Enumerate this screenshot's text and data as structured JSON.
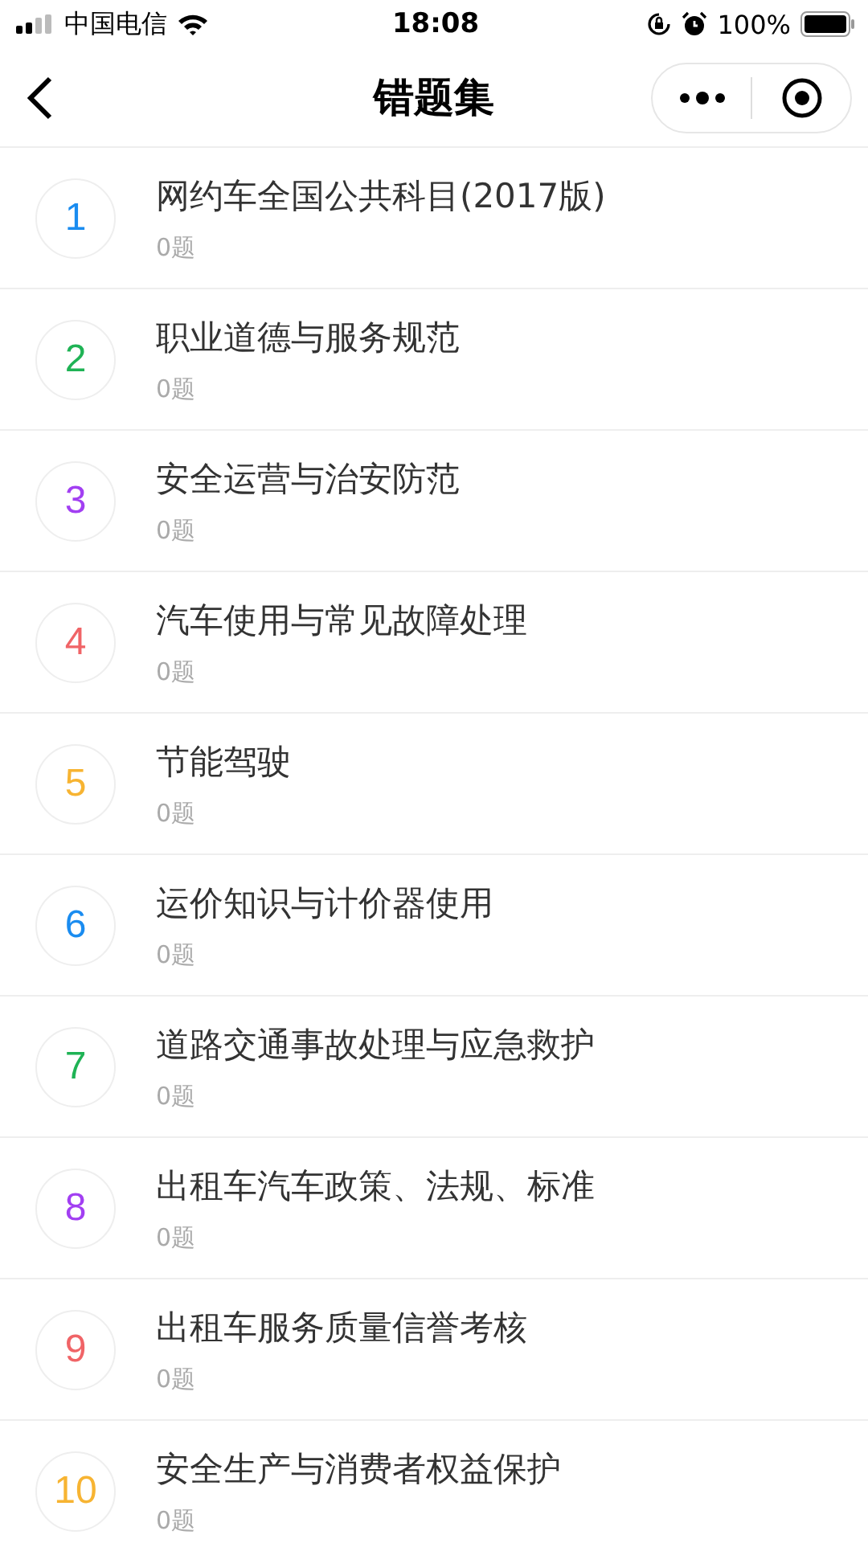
{
  "status_bar": {
    "carrier": "中国电信",
    "time": "18:08",
    "battery": "100%"
  },
  "nav_bar": {
    "title": "错题集"
  },
  "topics": [
    {
      "number": "1",
      "title": "网约车全国公共科目(2017版)",
      "count": "0题",
      "color": "#1a8cf0"
    },
    {
      "number": "2",
      "title": "职业道德与服务规范",
      "count": "0题",
      "color": "#1fb355"
    },
    {
      "number": "3",
      "title": "安全运营与治安防范",
      "count": "0题",
      "color": "#a23ff2"
    },
    {
      "number": "4",
      "title": "汽车使用与常见故障处理",
      "count": "0题",
      "color": "#f06467"
    },
    {
      "number": "5",
      "title": "节能驾驶",
      "count": "0题",
      "color": "#f7b432"
    },
    {
      "number": "6",
      "title": "运价知识与计价器使用",
      "count": "0题",
      "color": "#1a8cf0"
    },
    {
      "number": "7",
      "title": "道路交通事故处理与应急救护",
      "count": "0题",
      "color": "#1fb355"
    },
    {
      "number": "8",
      "title": "出租车汽车政策、法规、标准",
      "count": "0题",
      "color": "#a23ff2"
    },
    {
      "number": "9",
      "title": "出租车服务质量信誉考核",
      "count": "0题",
      "color": "#f06467"
    },
    {
      "number": "10",
      "title": "安全生产与消费者权益保护",
      "count": "0题",
      "color": "#f7b432"
    }
  ]
}
